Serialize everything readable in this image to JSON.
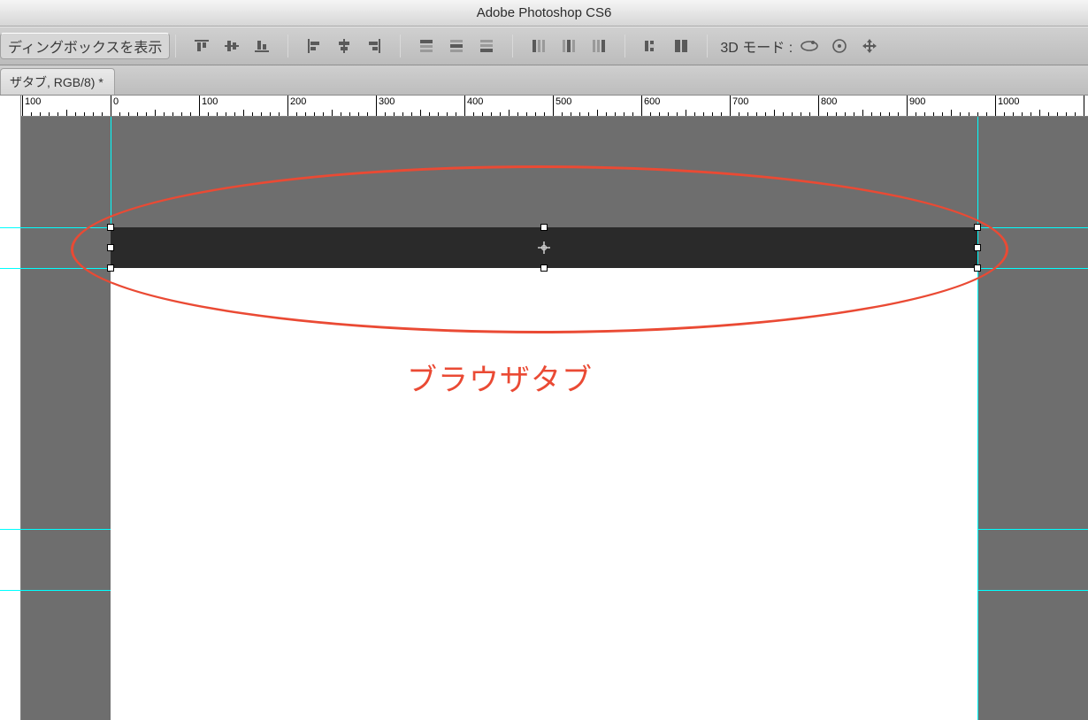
{
  "app": {
    "title": "Adobe Photoshop CS6"
  },
  "options": {
    "show_bounding_box_label": "ディングボックスを表示",
    "mode3d_label": "3D モード :"
  },
  "doc_tab": {
    "label": "ザタブ, RGB/8) *"
  },
  "ruler": {
    "labels": [
      "100",
      "0",
      "100",
      "200",
      "300",
      "400",
      "500",
      "600",
      "700",
      "800",
      "900",
      "1000"
    ]
  },
  "annotation": {
    "label": "ブラウザタブ"
  }
}
